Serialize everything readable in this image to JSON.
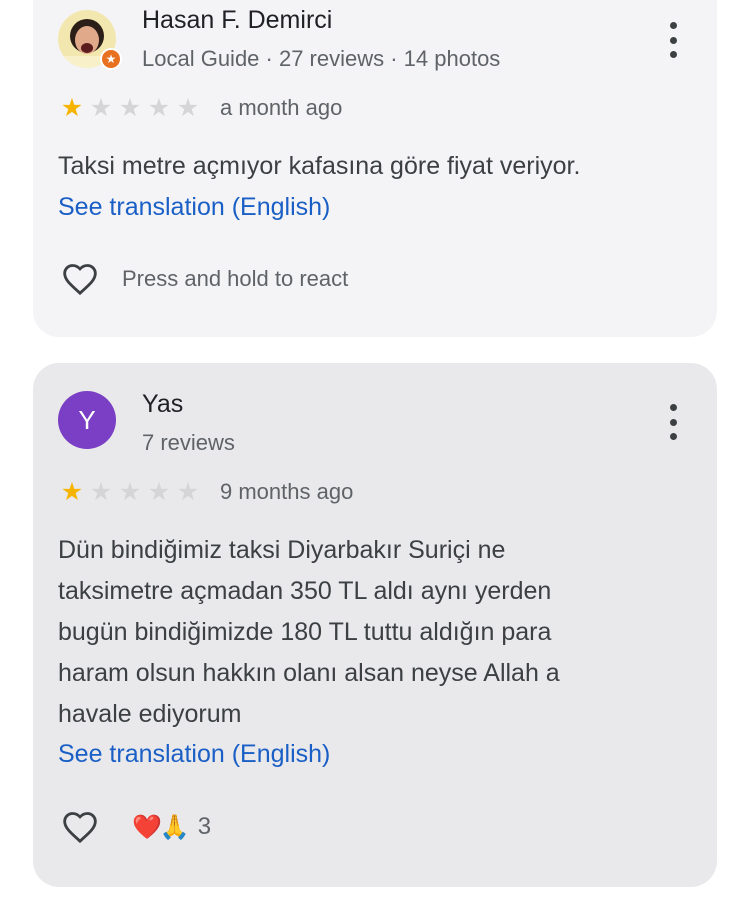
{
  "reviews": [
    {
      "author": "Hasan F. Demirci",
      "meta": "Local Guide · 27 reviews · 14 photos",
      "avatar": "photo",
      "rating": 1,
      "date": "a month ago",
      "text": "Taksi metre açmıyor kafasına göre fiyat veriyor.",
      "translate_label": "See translation (English)",
      "react_hint": "Press and hold to react"
    },
    {
      "author": "Yas",
      "meta": "7 reviews",
      "avatar_initial": "Y",
      "avatar_color": "#7a3fc4",
      "rating": 1,
      "date": "9 months ago",
      "text": "Dün bindiğimiz taksi Diyarbakır Suriçi ne\ntaksimetre açmadan 350 TL aldı aynı yerden\nbugün bindiğimizde 180 TL tuttu aldığın para\nharam olsun hakkın olanı alsan neyse Allah a\nhavale ediyorum",
      "translate_label": "See translation (English)",
      "reaction_emojis": "❤️🙏",
      "reaction_count": "3"
    }
  ],
  "icons": {
    "more": "more-vert-icon",
    "heart": "heart-outline-icon",
    "star": "star-icon",
    "badge": "local-guide-badge-icon"
  },
  "colors": {
    "star_filled": "#f6b400",
    "star_empty": "#d5d5d8",
    "link": "#1a5fc6"
  }
}
